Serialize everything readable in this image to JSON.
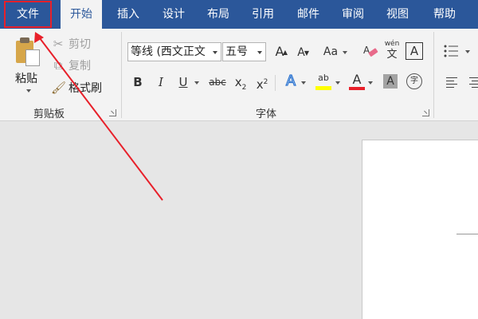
{
  "tabs": [
    {
      "id": "file",
      "label": "文件"
    },
    {
      "id": "home",
      "label": "开始"
    },
    {
      "id": "insert",
      "label": "插入"
    },
    {
      "id": "design",
      "label": "设计"
    },
    {
      "id": "layout",
      "label": "布局"
    },
    {
      "id": "references",
      "label": "引用"
    },
    {
      "id": "mailings",
      "label": "邮件"
    },
    {
      "id": "review",
      "label": "审阅"
    },
    {
      "id": "view",
      "label": "视图"
    },
    {
      "id": "help",
      "label": "帮助"
    }
  ],
  "clipboard": {
    "paste_label": "粘贴",
    "cut_label": "剪切",
    "copy_label": "复制",
    "format_painter_label": "格式刷",
    "group_label": "剪贴板"
  },
  "font": {
    "font_name": "等线 (西文正文",
    "font_size": "五号",
    "grow_label": "A",
    "shrink_label": "A",
    "case_label": "Aa",
    "phonetic_top": "wén",
    "phonetic_bottom": "文",
    "border_char": "A",
    "bold": "B",
    "italic": "I",
    "underline": "U",
    "strike": "abc",
    "subscript": "x",
    "subscript_mark": "2",
    "superscript": "x",
    "superscript_mark": "2",
    "effects": "A",
    "highlight": "ab",
    "color": "A",
    "shade": "A",
    "enclose": "字",
    "group_label": "字体"
  },
  "colors": {
    "ribbon_blue": "#2b579a",
    "highlight_yellow": "#ffff00",
    "font_red": "#e8202a",
    "annotation_red": "#e8202a"
  }
}
